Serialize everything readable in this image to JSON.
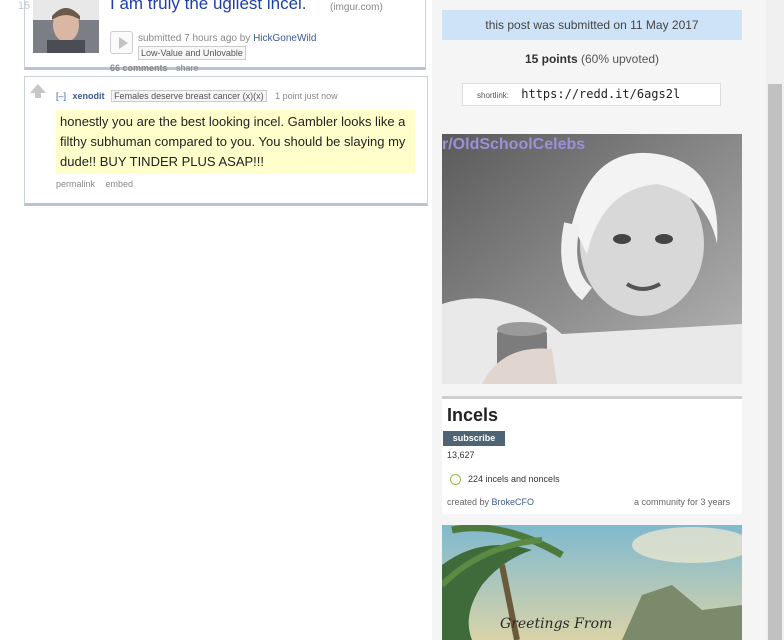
{
  "post": {
    "rank": "15",
    "title": "I am truly the ugliest incel.",
    "domain": "(imgur.com)",
    "submitted_prefix": "submitted 7 hours ago by",
    "author": "HickGoneWild",
    "flair": "Low-Value and Unlovable",
    "comments": "66 comments",
    "share": "share"
  },
  "comment": {
    "collapse": "[–]",
    "author": "xenodit",
    "flair": "Females deserve breast cancer (x)(x)",
    "meta": "1 point just now",
    "body": "honestly you are the best looking incel. Gambler looks like a filthy subhuman compared to you. You should be slaying my dude!! BUY TINDER PLUS ASAP!!!",
    "permalink": "permalink",
    "embed": "embed"
  },
  "sidebar": {
    "submitted_text": "this post was submitted on 11 May 2017",
    "points": "15 points",
    "upvoted": "(60% upvoted)",
    "shortlink_label": "shortlink:",
    "shortlink_url": "https://redd.it/6ags2l",
    "ad_caption": "r/OldSchoolCelebs",
    "subreddit": {
      "name": "Incels",
      "subscribe_label": "subscribe",
      "subscribers": "13,627",
      "online": "224 incels and noncels",
      "created_prefix": "created by",
      "created_by": "BrokeCFO",
      "age": "a community for 3 years"
    },
    "ad2_text": "Greetings From"
  },
  "colors": {
    "link_blue": "#1f3fa8",
    "submitted_bg": "#cee3f8",
    "comment_highlight": "#ffffcc",
    "subscribe_bg": "#4e6474",
    "online_green": "#8cc44b"
  }
}
